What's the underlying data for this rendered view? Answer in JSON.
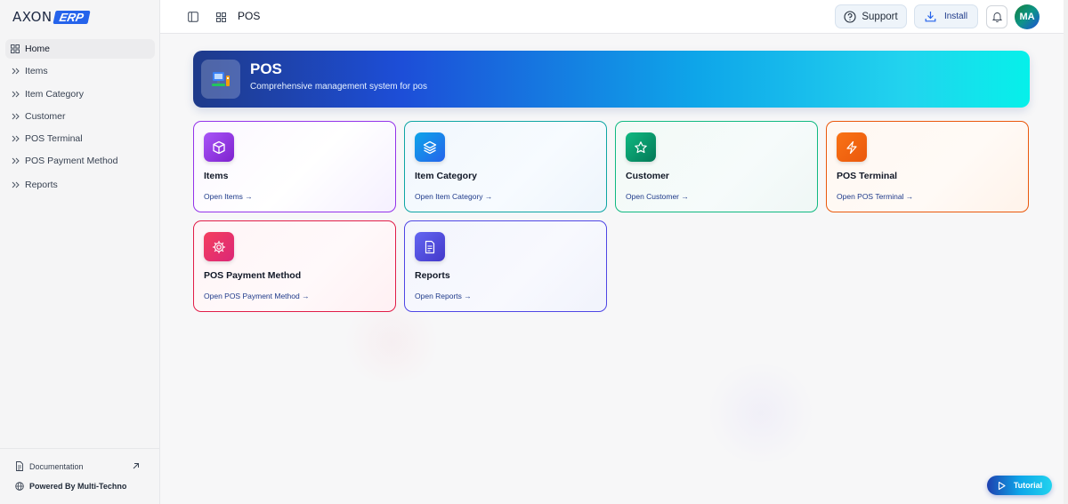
{
  "app": {
    "logo_left": "AXON",
    "logo_right": "ERP"
  },
  "sidebar": {
    "items": [
      {
        "label": "Home",
        "icon": "grid-icon",
        "active": true
      },
      {
        "label": "Items",
        "icon": "chevrons-right-icon"
      },
      {
        "label": "Item Category",
        "icon": "chevrons-right-icon"
      },
      {
        "label": "Customer",
        "icon": "chevrons-right-icon"
      },
      {
        "label": "POS Terminal",
        "icon": "chevrons-right-icon"
      },
      {
        "label": "POS Payment Method",
        "icon": "chevrons-right-icon"
      },
      {
        "label": "Reports",
        "icon": "chevrons-right-icon"
      }
    ],
    "documentation": "Documentation",
    "powered_by": "Powered By Multi-Techno"
  },
  "topbar": {
    "title": "POS",
    "support_label": "Support",
    "install_label": "Install",
    "avatar_initials": "MA"
  },
  "banner": {
    "title": "POS",
    "subtitle": "Comprehensive management system for pos"
  },
  "cards": [
    {
      "title": "Items",
      "link": "Open Items →",
      "icon": "box-icon",
      "color": "#9333ea"
    },
    {
      "title": "Item Category",
      "link": "Open Item Category →",
      "icon": "layers-icon",
      "color": "#0284c7"
    },
    {
      "title": "Customer",
      "link": "Open Customer →",
      "icon": "star-icon",
      "color": "#059669"
    },
    {
      "title": "POS Terminal",
      "link": "Open POS Terminal →",
      "icon": "bolt-icon",
      "color": "#ea580c"
    },
    {
      "title": "POS Payment Method",
      "link": "Open POS Payment Method →",
      "icon": "gear-icon",
      "color": "#e11d48"
    },
    {
      "title": "Reports",
      "link": "Open Reports →",
      "icon": "document-icon",
      "color": "#4f46e5"
    }
  ],
  "tutorial_label": "Tutorial"
}
